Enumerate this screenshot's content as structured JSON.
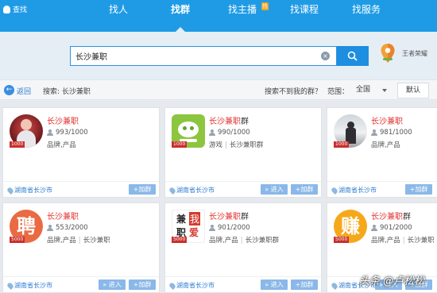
{
  "app": {
    "title": "查找"
  },
  "nav": {
    "tabs": [
      {
        "label": "找人"
      },
      {
        "label": "找群",
        "active": true
      },
      {
        "label": "找主播",
        "badge": "热"
      },
      {
        "label": "找课程"
      },
      {
        "label": "找服务"
      }
    ]
  },
  "search": {
    "value": "长沙兼职",
    "location": "王者荣耀"
  },
  "filter": {
    "back": "返回",
    "summary": "搜索: 长沙兼职",
    "not_found": "搜索不到我的群？",
    "range_label": "范围：",
    "range_value": "全国",
    "sort": "默认"
  },
  "cards": [
    {
      "name": "长沙兼职",
      "suffix": "",
      "members": "993/1000",
      "tags": [
        "品牌,产品"
      ],
      "level": "1000",
      "location": "湖南省长沙市",
      "enter": "",
      "join": "+加群"
    },
    {
      "name": "长沙兼职",
      "suffix": "群",
      "members": "990/1000",
      "tags": [
        "游戏",
        "长沙兼职群"
      ],
      "level": "1000",
      "location": "湖南省长沙市",
      "enter": "» 进入",
      "join": "+加群"
    },
    {
      "name": "长沙兼职",
      "suffix": "",
      "members": "981/1000",
      "tags": [
        "品牌,产品"
      ],
      "level": "1000",
      "location": "湖南省长沙市",
      "enter": "",
      "join": "+加群"
    },
    {
      "name": "长沙兼职",
      "suffix": "",
      "members": "553/2000",
      "tags": [
        "品牌,产品",
        "长沙兼职"
      ],
      "level": "5000",
      "location": "湖南省长沙市",
      "enter": "» 进入",
      "join": "+加群"
    },
    {
      "name": "长沙兼职",
      "suffix": "群",
      "members": "901/2000",
      "tags": [
        "品牌,产品",
        "长沙兼职群"
      ],
      "level": "5000",
      "location": "湖南省长沙市",
      "enter": "» 进入",
      "join": "+加群"
    },
    {
      "name": "长沙兼职",
      "suffix": "群",
      "members": "901/2000",
      "tags": [
        "品牌,产品",
        "长沙兼职"
      ],
      "level": "5000",
      "location": "湖南省长沙市",
      "enter": "» 进入",
      "join": "+加群"
    }
  ],
  "avatar_glyphs": {
    "card4": "聘",
    "card5_a": "兼",
    "card5_b": "我",
    "card5_c": "职",
    "card5_d": "爱",
    "card6": "赚"
  },
  "watermark": "头条 @卢松松",
  "colors": {
    "topbar": "#1f9be6",
    "accent_red": "#e0312e",
    "link_blue": "#2a7ad0"
  }
}
